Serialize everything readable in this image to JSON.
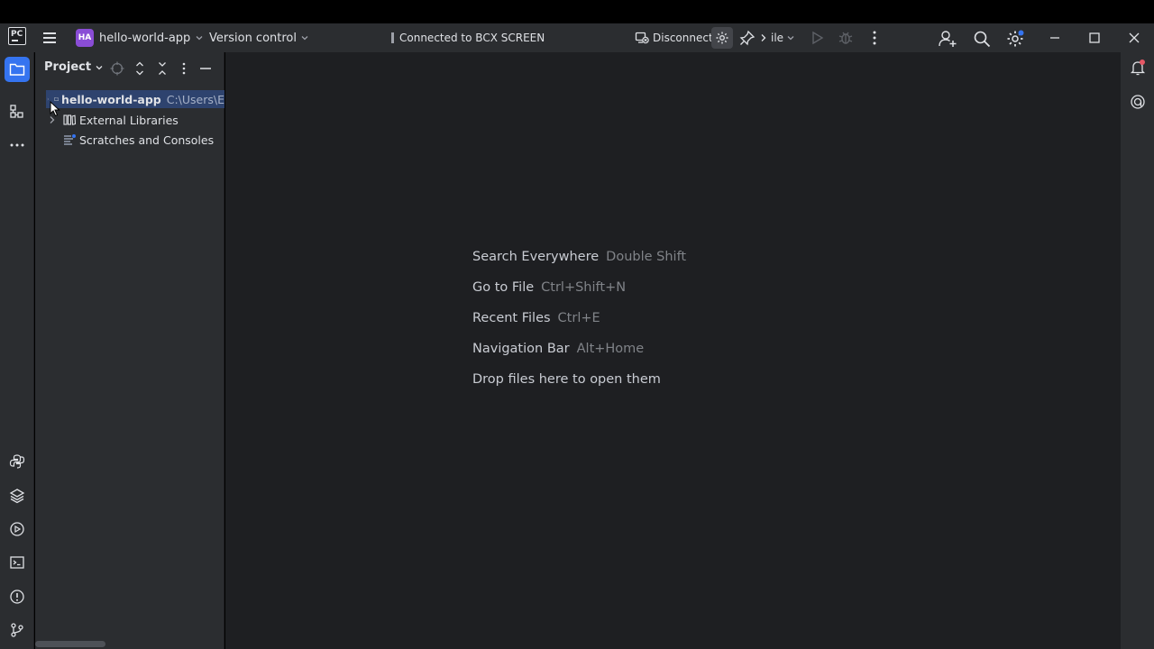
{
  "titlebar": {
    "logo_text": "PC",
    "project_badge": "HA",
    "project_name": "hello-world-app",
    "vcs_label": "Version control",
    "connection_status": "Connected to BCX SCREEN",
    "disconnect_label": "Disconnect",
    "run_config_label": "ile"
  },
  "project_panel": {
    "title": "Project",
    "tree": [
      {
        "label": "hello-world-app",
        "path": "C:\\Users\\E",
        "selected": true
      },
      {
        "label": "External Libraries",
        "path": "",
        "selected": false
      },
      {
        "label": "Scratches and Consoles",
        "path": "",
        "selected": false
      }
    ]
  },
  "editor": {
    "hints": [
      {
        "action": "Search Everywhere",
        "shortcut": "Double Shift"
      },
      {
        "action": "Go to File",
        "shortcut": "Ctrl+Shift+N"
      },
      {
        "action": "Recent Files",
        "shortcut": "Ctrl+E"
      },
      {
        "action": "Navigation Bar",
        "shortcut": "Alt+Home"
      },
      {
        "action": "Drop files here to open them",
        "shortcut": ""
      }
    ]
  },
  "colors": {
    "accent": "#3574f0",
    "project_badge": "#8a4dd6",
    "panel_bg": "#2b2d30",
    "editor_bg": "#1e1f22"
  }
}
